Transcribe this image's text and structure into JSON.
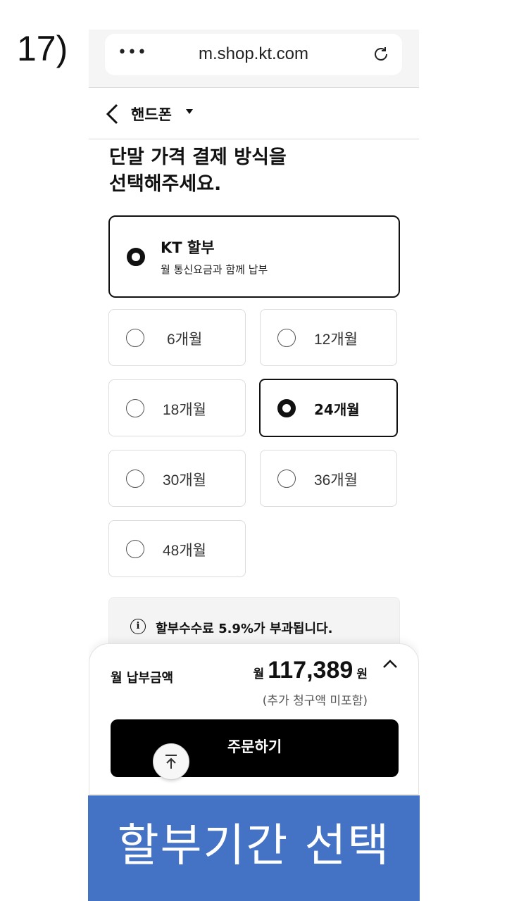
{
  "step_label": "17)",
  "browser": {
    "url": "m.shop.kt.com",
    "menu_icon": "more-dots-icon",
    "reload_icon": "reload-icon"
  },
  "nav": {
    "title": "핸드폰",
    "back_icon": "chevron-left-icon",
    "dropdown_icon": "caret-down-icon"
  },
  "heading": {
    "line1": "단말 가격 결제 방식을",
    "line2": "선택해주세요."
  },
  "payment_method": {
    "title": "KT 할부",
    "subtitle": "월 통신요금과 함께 납부",
    "selected": true
  },
  "installment_options": [
    {
      "label": "6개월",
      "selected": false
    },
    {
      "label": "12개월",
      "selected": false
    },
    {
      "label": "18개월",
      "selected": false
    },
    {
      "label": "24개월",
      "selected": true
    },
    {
      "label": "30개월",
      "selected": false
    },
    {
      "label": "36개월",
      "selected": false
    },
    {
      "label": "48개월",
      "selected": false
    }
  ],
  "notice": {
    "icon": "info-icon",
    "text": "할부수수료 5.9%가 부과됩니다."
  },
  "summary": {
    "label": "월 납부금액",
    "prefix": "월",
    "amount": "117,389",
    "suffix": "원",
    "note": "(추가 청구액 미포함)",
    "collapse_icon": "chevron-up-icon"
  },
  "order_button": "주문하기",
  "scroll_top_icon": "arrow-up-icon",
  "caption": "할부기간 선택"
}
